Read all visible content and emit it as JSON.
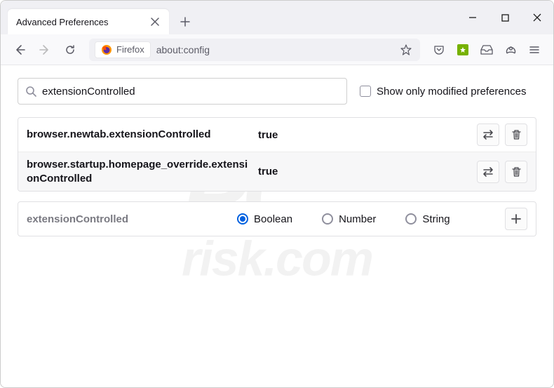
{
  "window": {
    "tab_title": "Advanced Preferences"
  },
  "navbar": {
    "identity_label": "Firefox",
    "address": "about:config"
  },
  "search": {
    "value": "extensionControlled",
    "filter_label": "Show only modified preferences"
  },
  "prefs": [
    {
      "name": "browser.newtab.extensionControlled",
      "value": "true"
    },
    {
      "name": "browser.startup.homepage_override.extensionControlled",
      "value": "true"
    }
  ],
  "add": {
    "name": "extensionControlled",
    "types": {
      "boolean": "Boolean",
      "number": "Number",
      "string": "String"
    },
    "selected": "boolean"
  }
}
